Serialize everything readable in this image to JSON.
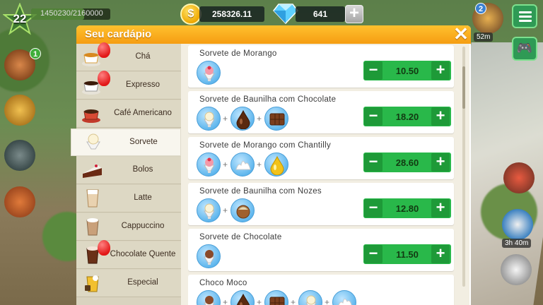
{
  "hud": {
    "level": "22",
    "xp": "1450230/2160000",
    "xp_fraction": 0.671,
    "coins": "258326.11",
    "coin_symbol": "$",
    "gems": "641",
    "notification_count": "2",
    "timer_top": "52m",
    "timer_bottom": "3h 40m",
    "book_badge": "1"
  },
  "panel": {
    "title": "Seu cardápio",
    "close_label": "✕"
  },
  "categories": [
    {
      "label": "Chá",
      "icon": "tea-cup-icon",
      "balloon": true
    },
    {
      "label": "Expresso",
      "icon": "espresso-cup-icon",
      "balloon": true
    },
    {
      "label": "Café Americano",
      "icon": "coffee-cup-icon",
      "balloon": false
    },
    {
      "label": "Sorvete",
      "icon": "ice-cream-icon",
      "balloon": false,
      "active": true
    },
    {
      "label": "Bolos",
      "icon": "cake-slice-icon",
      "balloon": false
    },
    {
      "label": "Latte",
      "icon": "latte-glass-icon",
      "balloon": false
    },
    {
      "label": "Cappuccino",
      "icon": "cappuccino-glass-icon",
      "balloon": false
    },
    {
      "label": "Chocolate Quente",
      "icon": "hot-chocolate-icon",
      "balloon": true
    },
    {
      "label": "Especial",
      "icon": "special-drink-icon",
      "balloon": false
    }
  ],
  "items": [
    {
      "name": "Sorvete de Morango",
      "price": "10.50",
      "ingredients": [
        "strawberry-sundae-icon"
      ]
    },
    {
      "name": "Sorvete de Baunilha com Chocolate",
      "price": "18.20",
      "ingredients": [
        "vanilla-sundae-icon",
        "chocolate-drop-icon",
        "chocolate-bar-icon"
      ]
    },
    {
      "name": "Sorvete de Morango com Chantilly",
      "price": "28.60",
      "ingredients": [
        "strawberry-sundae-icon",
        "whipped-cream-icon",
        "honey-drop-icon"
      ]
    },
    {
      "name": "Sorvete de Baunilha com Nozes",
      "price": "12.80",
      "ingredients": [
        "vanilla-sundae-icon",
        "hazelnut-icon"
      ]
    },
    {
      "name": "Sorvete de Chocolate",
      "price": "11.50",
      "ingredients": [
        "chocolate-sundae-icon"
      ]
    },
    {
      "name": "Choco Moco",
      "price": "",
      "ingredients": [
        "chocolate-sundae-icon",
        "chocolate-drop-icon",
        "chocolate-bar-icon",
        "vanilla-sundae-icon",
        "whipped-cream-icon"
      ]
    }
  ],
  "controls": {
    "minus": "−",
    "plus": "+",
    "ingredient_join": "+"
  },
  "colors": {
    "accent": "#f59d12",
    "price_green": "#29b84a",
    "ingredient_blue": "#5bb4ec"
  }
}
